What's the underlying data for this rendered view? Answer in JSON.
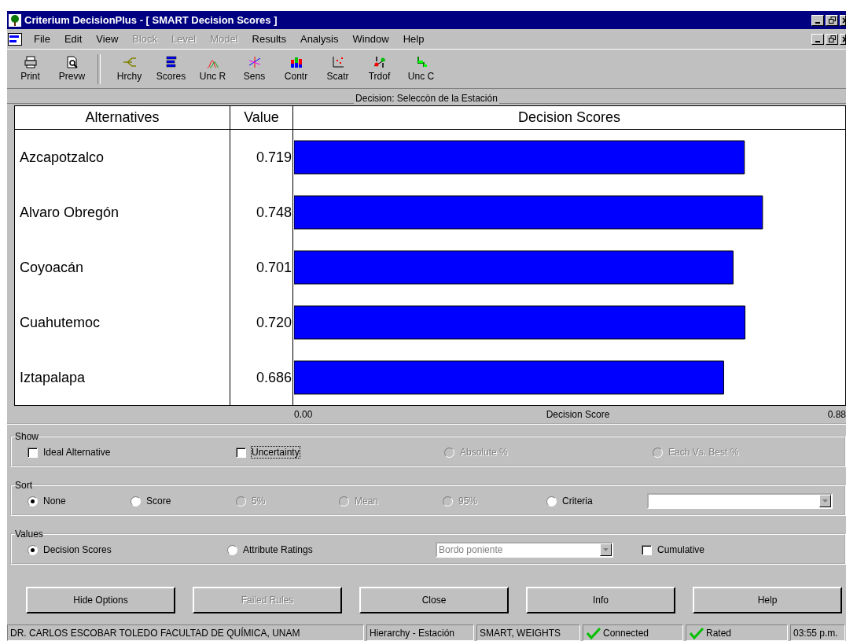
{
  "window": {
    "title": "Criterium DecisionPlus - [ SMART Decision Scores ]"
  },
  "menu": [
    {
      "label": "File",
      "disabled": false
    },
    {
      "label": "Edit",
      "disabled": false
    },
    {
      "label": "View",
      "disabled": false
    },
    {
      "label": "Block",
      "disabled": true
    },
    {
      "label": "Level",
      "disabled": true
    },
    {
      "label": "Model",
      "disabled": true
    },
    {
      "label": "Results",
      "disabled": false
    },
    {
      "label": "Analysis",
      "disabled": false
    },
    {
      "label": "Window",
      "disabled": false
    },
    {
      "label": "Help",
      "disabled": false
    }
  ],
  "toolbar": [
    {
      "kind": "print",
      "label": "Print"
    },
    {
      "kind": "preview",
      "label": "Prevw"
    },
    {
      "kind": "separator"
    },
    {
      "kind": "hierarchy",
      "label": "Hrchy"
    },
    {
      "kind": "scores",
      "label": "Scores"
    },
    {
      "kind": "uncertainty",
      "label": "Unc R"
    },
    {
      "kind": "sensitivity",
      "label": "Sens"
    },
    {
      "kind": "contribution",
      "label": "Contr"
    },
    {
      "kind": "scatter",
      "label": "Scatr"
    },
    {
      "kind": "tradeoff",
      "label": "Trdof"
    },
    {
      "kind": "uncc",
      "label": "Unc C"
    }
  ],
  "decision_label": "Decision: Seleccòn de la Estación",
  "table": {
    "columns": [
      "Alternatives",
      "Value"
    ]
  },
  "chart_data": {
    "type": "bar",
    "orientation": "horizontal",
    "title": "Decision Scores",
    "xlabel": "Decision Score",
    "categories": [
      "Azcapotzalco",
      "Alvaro Obregón",
      "Coyoacán",
      "Cuahutemoc",
      "Iztapalapa"
    ],
    "values": [
      0.719,
      0.748,
      0.701,
      0.72,
      0.686
    ],
    "value_labels": [
      "0.719",
      "0.748",
      "0.701",
      "0.720",
      "0.686"
    ],
    "xlim": [
      0,
      0.88
    ]
  },
  "scale_labels": [
    "0.00",
    "0.88"
  ],
  "show": {
    "legend": "Show",
    "options": [
      {
        "kind": "checkbox",
        "label": "Ideal Alternative",
        "checked": false,
        "disabled": false,
        "focused": false
      },
      {
        "kind": "checkbox",
        "label": "Uncertainty",
        "checked": false,
        "disabled": false,
        "focused": true
      },
      {
        "kind": "radio",
        "label": "Absolute %",
        "selected": false,
        "disabled": true,
        "focused": false
      },
      {
        "kind": "radio",
        "label": "Each Vs. Best %",
        "selected": false,
        "disabled": true,
        "focused": false
      }
    ]
  },
  "sort": {
    "legend": "Sort",
    "options": [
      {
        "kind": "radio",
        "label": "None",
        "selected": true,
        "disabled": false
      },
      {
        "kind": "radio",
        "label": "Score",
        "selected": false,
        "disabled": false
      },
      {
        "kind": "radio",
        "label": "5%",
        "selected": false,
        "disabled": true
      },
      {
        "kind": "radio",
        "label": "Mean",
        "selected": false,
        "disabled": true
      },
      {
        "kind": "radio",
        "label": "95%",
        "selected": false,
        "disabled": true
      },
      {
        "kind": "radio",
        "label": "Criteria",
        "selected": false,
        "disabled": false
      },
      {
        "kind": "combo"
      }
    ]
  },
  "values": {
    "legend": "Values",
    "options": [
      {
        "kind": "radio",
        "label": "Decision Scores",
        "selected": true,
        "disabled": false
      },
      {
        "kind": "radio",
        "label": "Attribute Ratings",
        "selected": false,
        "disabled": false
      },
      {
        "kind": "combo",
        "value": "Bordo poniente",
        "disabled": true
      },
      {
        "kind": "checkbox",
        "label": "Cumulative",
        "checked": false,
        "disabled": false
      }
    ]
  },
  "buttons": [
    {
      "label": "Hide Options",
      "disabled": false
    },
    {
      "label": "Failed Rules",
      "disabled": true
    },
    {
      "label": "Close",
      "disabled": false
    },
    {
      "label": "Info",
      "disabled": false
    },
    {
      "label": "Help",
      "disabled": false
    }
  ],
  "status_bar": [
    {
      "text": "DR. CARLOS ESCOBAR TOLEDO FACULTAD DE QUÍMICA, UNAM",
      "ok": false
    },
    {
      "text": "Hierarchy - Estación",
      "ok": false
    },
    {
      "text": "SMART, WEIGHTS",
      "ok": false
    },
    {
      "text": "Connected",
      "ok": true
    },
    {
      "text": "Rated",
      "ok": true
    },
    {
      "text": "03:55 p.m.",
      "ok": false
    }
  ]
}
